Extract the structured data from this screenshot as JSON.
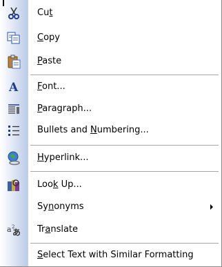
{
  "menu": {
    "items": [
      {
        "id": "cut",
        "icon": "scissors-icon",
        "before": "Cu",
        "key": "t",
        "after": ""
      },
      {
        "id": "copy",
        "icon": "copy-icon",
        "before": "",
        "key": "C",
        "after": "opy"
      },
      {
        "id": "paste",
        "icon": "paste-icon",
        "before": "",
        "key": "P",
        "after": "aste"
      },
      {
        "id": "font",
        "icon": "font-icon",
        "before": "",
        "key": "F",
        "after": "ont..."
      },
      {
        "id": "paragraph",
        "icon": "paragraph-icon",
        "before": "",
        "key": "P",
        "after": "aragraph..."
      },
      {
        "id": "bullets",
        "icon": "bullets-icon",
        "before": "Bullets and ",
        "key": "N",
        "after": "umbering..."
      },
      {
        "id": "hyperlink",
        "icon": "hyperlink-icon",
        "before": "",
        "key": "H",
        "after": "yperlink..."
      },
      {
        "id": "lookup",
        "icon": "research-icon",
        "before": "Loo",
        "key": "k",
        "after": " Up..."
      },
      {
        "id": "synonyms",
        "icon": "",
        "before": "Sy",
        "key": "n",
        "after": "onyms"
      },
      {
        "id": "translate",
        "icon": "translate-icon",
        "before": "Tr",
        "key": "a",
        "after": "nslate"
      },
      {
        "id": "select-similar",
        "icon": "",
        "before": "",
        "key": "S",
        "after": "elect Text with Similar Formatting"
      }
    ]
  }
}
